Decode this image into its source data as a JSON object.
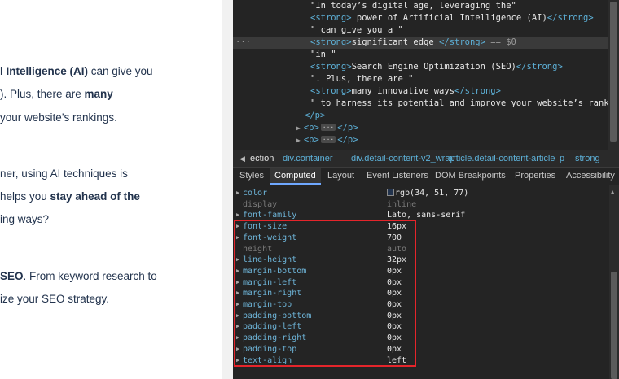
{
  "page": {
    "lines": [
      {
        "pre": "",
        "strong": "l Intelligence (AI)",
        "post": " can give you"
      },
      {
        "pre": "). Plus, there are ",
        "strong": "many",
        "post": ""
      },
      {
        "pre": "your website’s rankings.",
        "strong": "",
        "post": ""
      },
      {
        "pre": "ner, using AI techniques is",
        "strong": "",
        "post": ""
      },
      {
        "pre": "helps you ",
        "strong": "stay ahead of the",
        "post": ""
      },
      {
        "pre": "ing ways?",
        "strong": "",
        "post": ""
      },
      {
        "pre": "",
        "strong": "SEO",
        "post": ". From keyword research to"
      },
      {
        "pre": "ize your SEO strategy.",
        "strong": "",
        "post": ""
      }
    ]
  },
  "elements": {
    "line1": "\"In today’s digital age, leveraging the\"",
    "line2_open": "<strong>",
    "line2_text": " power of Artificial Intelligence (AI)",
    "line2_close": "</strong>",
    "line3": "\" can give you a \"",
    "line4_dots": "···",
    "line4_open": "<strong>",
    "line4_text": "significant edge ",
    "line4_close": "</strong>",
    "line4_eq": " == $0",
    "line5": "\"in \"",
    "line6_open": "<strong>",
    "line6_text": "Search Engine Optimization (SEO)",
    "line6_close": "</strong>",
    "line7": "\". Plus, there are \"",
    "line8_open": "<strong>",
    "line8_text": "many innovative ways",
    "line8_close": "</strong>",
    "line9": "\" to harness its potential and improve your website’s rankings.\"",
    "line10": "</p>",
    "line11_open": "<p>",
    "line11_ell": "···",
    "line11_close": "</p>",
    "line12_open": "<p>",
    "line12_ell": "···",
    "line12_close": "</p>"
  },
  "breadcrumbs": [
    "ection",
    "div.container",
    "div.detail-content-v2_wrap",
    "article.detail-content-article",
    "p",
    "strong"
  ],
  "tabs": [
    "Styles",
    "Computed",
    "Layout",
    "Event Listeners",
    "DOM Breakpoints",
    "Properties",
    "Accessibility"
  ],
  "active_tab": "Computed",
  "computed": [
    {
      "name": "color",
      "value": "rgb(34, 51, 77)",
      "inherited": false,
      "swatch": "#22334d"
    },
    {
      "name": "display",
      "value": "inline",
      "inherited": true
    },
    {
      "name": "font-family",
      "value": "Lato, sans-serif",
      "inherited": false
    },
    {
      "name": "font-size",
      "value": "16px",
      "inherited": false
    },
    {
      "name": "font-weight",
      "value": "700",
      "inherited": false
    },
    {
      "name": "height",
      "value": "auto",
      "inherited": true
    },
    {
      "name": "line-height",
      "value": "32px",
      "inherited": false
    },
    {
      "name": "margin-bottom",
      "value": "0px",
      "inherited": false
    },
    {
      "name": "margin-left",
      "value": "0px",
      "inherited": false
    },
    {
      "name": "margin-right",
      "value": "0px",
      "inherited": false
    },
    {
      "name": "margin-top",
      "value": "0px",
      "inherited": false
    },
    {
      "name": "padding-bottom",
      "value": "0px",
      "inherited": false
    },
    {
      "name": "padding-left",
      "value": "0px",
      "inherited": false
    },
    {
      "name": "padding-right",
      "value": "0px",
      "inherited": false
    },
    {
      "name": "padding-top",
      "value": "0px",
      "inherited": false
    },
    {
      "name": "text-align",
      "value": "left",
      "inherited": false
    }
  ],
  "colors": {
    "highlight": "#e5252b",
    "tag": "#5db0d7",
    "text": "#22334d"
  }
}
